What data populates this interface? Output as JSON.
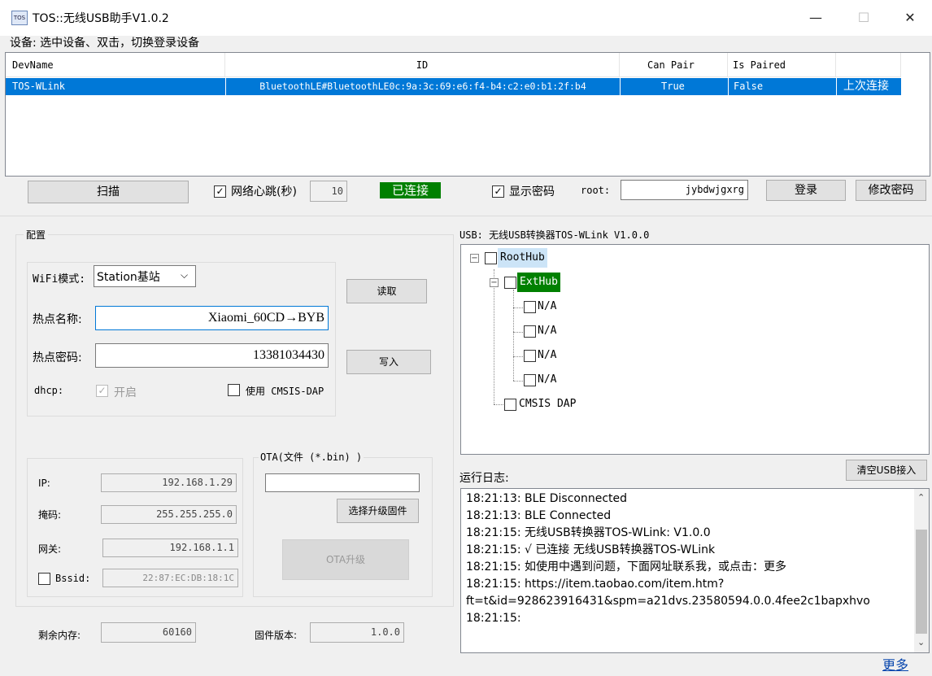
{
  "window": {
    "title": "TOS::无线USB助手V1.0.2",
    "app_icon": "TOS",
    "minimize": "—",
    "maximize": "☐",
    "close": "✕"
  },
  "devices": {
    "hint": "设备:  选中设备、双击，切换登录设备",
    "columns": [
      "DevName",
      "ID",
      "Can Pair",
      "Is Paired",
      ""
    ],
    "rows": [
      {
        "name": "TOS-WLink",
        "id": "BluetoothLE#BluetoothLE0c:9a:3c:69:e6:f4-b4:c2:e0:b1:2f:b4",
        "can_pair": "True",
        "is_paired": "False",
        "action": "上次连接"
      }
    ]
  },
  "toolbar": {
    "scan": "扫描",
    "heartbeat_label": "网络心跳(秒)",
    "heartbeat_checked": true,
    "heartbeat_value": "10",
    "status": "已连接",
    "status_color": "#008000",
    "show_password_label": "显示密码",
    "show_password_checked": true,
    "root_label": "root:",
    "password_value": "jybdwjgxrg",
    "login": "登录",
    "change_password": "修改密码"
  },
  "config": {
    "group_title": "配置",
    "wifi_mode_label": "WiFi模式:",
    "wifi_mode_value": "Station基站",
    "read_button": "读取",
    "ssid_label": "热点名称:",
    "ssid_value": "Xiaomi_60CD→BYB",
    "password_label": "热点密码:",
    "password_value": "13381034430",
    "write_button": "写入",
    "dhcp_label": "dhcp:",
    "dhcp_option": "开启",
    "dhcp_checked": true,
    "cmsis_label": "使用 CMSIS-DAP",
    "cmsis_checked": false,
    "ip_label": "IP:",
    "ip_value": "192.168.1.29",
    "mask_label": "掩码:",
    "mask_value": "255.255.255.0",
    "gateway_label": "网关:",
    "gateway_value": "192.168.1.1",
    "bssid_label": "Bssid:",
    "bssid_checked": false,
    "bssid_value": "22:87:EC:DB:18:1C",
    "ota_title": "OTA(文件 (*.bin) )",
    "ota_file_value": "",
    "select_firmware": "选择升级固件",
    "ota_upgrade": "OTA升级",
    "free_memory_label": "剩余内存:",
    "free_memory_value": "60160",
    "firmware_version_label": "固件版本:",
    "firmware_version_value": "1.0.0"
  },
  "usb": {
    "title": "USB: 无线USB转换器TOS-WLink V1.0.0",
    "root": "RootHub",
    "hub": "ExtHub",
    "ports": [
      "N/A",
      "N/A",
      "N/A",
      "N/A"
    ],
    "cmsis": "CMSIS DAP",
    "clear_button": "清空USB接入"
  },
  "log": {
    "label": "运行日志:",
    "lines": [
      "18:21:13: BLE Disconnected",
      "18:21:13: BLE Connected",
      "18:21:15: 无线USB转换器TOS-WLink: V1.0.0",
      "18:21:15:    √ 已连接 无线USB转换器TOS-WLink",
      "18:21:15: 如使用中遇到问题，下面网址联系我，或点击：更多",
      "18:21:15: https://item.taobao.com/item.htm?",
      "ft=t&id=928623916431&spm=a21dvs.23580594.0.0.4fee2c1bapxhvo",
      "18:21:15:"
    ],
    "more_link": "更多"
  }
}
